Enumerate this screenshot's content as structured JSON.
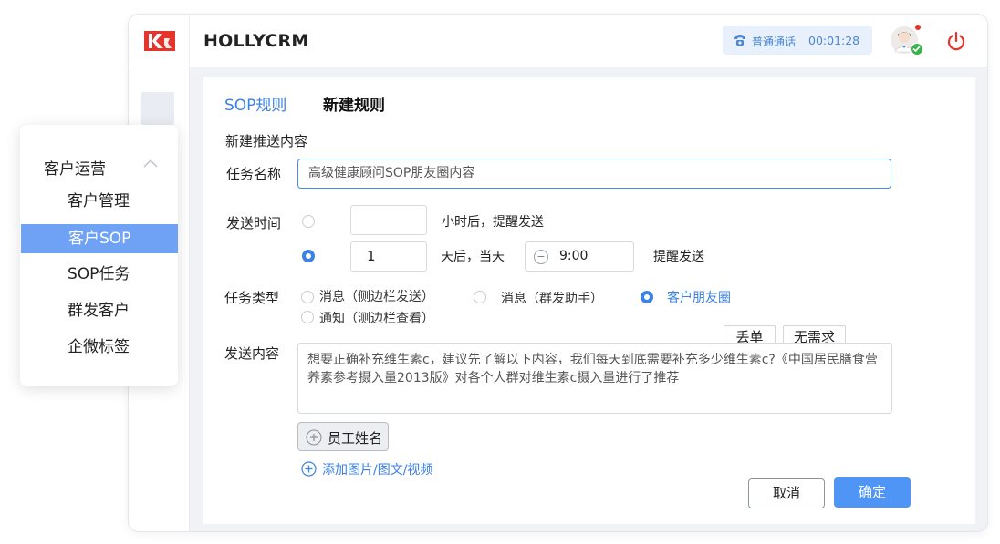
{
  "header": {
    "app_title": "HOLLYCRM",
    "call_status": "普通通话",
    "call_time": "00:01:28",
    "brand_color": "#e5342b",
    "accent_color": "#3b82e6"
  },
  "sidebar_menu": {
    "group_label": "客户运营",
    "items": [
      {
        "label": "客户管理",
        "active": false
      },
      {
        "label": "客户SOP",
        "active": true
      },
      {
        "label": "SOP任务",
        "active": false
      },
      {
        "label": "群发客户",
        "active": false
      },
      {
        "label": "企微标签",
        "active": false
      }
    ]
  },
  "tabs": {
    "sop_rules": "SOP规则",
    "new_rule": "新建规则"
  },
  "form": {
    "section_title": "新建推送内容",
    "task_name_label": "任务名称",
    "task_name_value": "高级健康顾问SOP朋友圈内容",
    "send_time_label": "发送时间",
    "option_hours": {
      "value": "",
      "suffix": "小时后，提醒发送",
      "selected": false
    },
    "option_days": {
      "value": "1",
      "suffix": "天后，当天",
      "time": "9:00",
      "time_suffix": "提醒发送",
      "selected": true
    },
    "task_type_label": "任务类型",
    "task_types": [
      {
        "label": "消息（侧边栏发送）",
        "selected": false
      },
      {
        "label": "消息（群发助手）",
        "selected": false
      },
      {
        "label": "客户朋友圈",
        "selected": true
      },
      {
        "label": "通知（测边栏查看）",
        "selected": false
      }
    ],
    "content_label": "发送内容",
    "tag_buttons": [
      "丢单",
      "无需求"
    ],
    "content_value": "想要正确补充维生素c，建议先了解以下内容，我们每天到底需要补充多少维生素c?《中国居民膳食营养素参考摄入量2013版》对各个人群对维生素c摄入量进行了推荐",
    "employee_name_button": "员工姓名",
    "add_media_link": "添加图片/图文/视频",
    "cancel_button": "取消",
    "confirm_button": "确定"
  }
}
